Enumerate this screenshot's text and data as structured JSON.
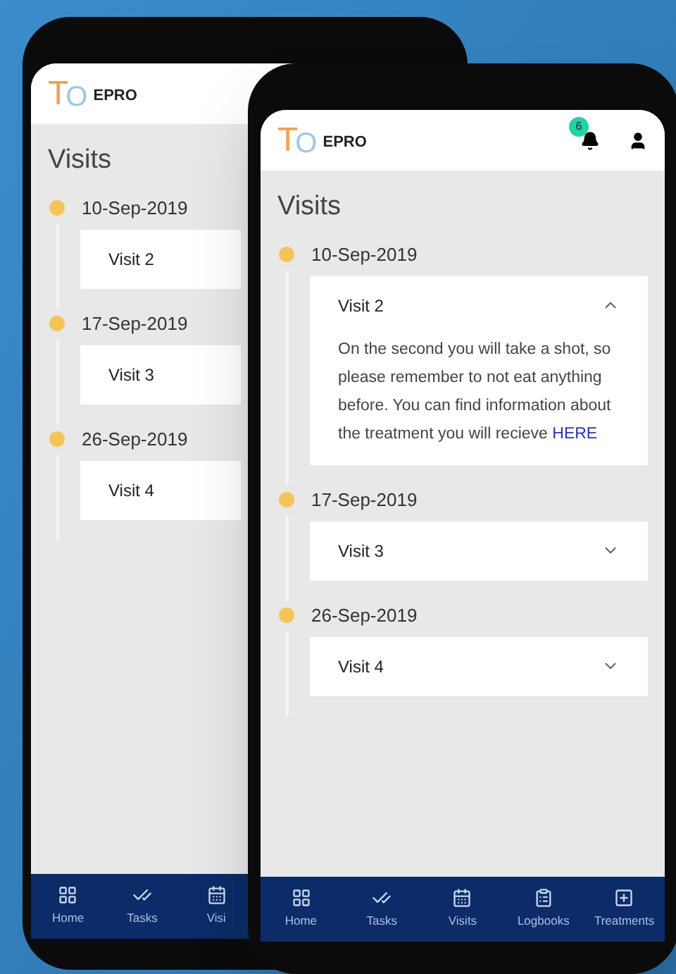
{
  "back_phone": {
    "logo": {
      "first": "T",
      "second": "O"
    },
    "app_name": "EPRO",
    "title": "Visits",
    "visits": [
      {
        "date": "10-Sep-2019",
        "title": "Visit 2"
      },
      {
        "date": "17-Sep-2019",
        "title": "Visit 3"
      },
      {
        "date": "26-Sep-2019",
        "title": "Visit 4"
      }
    ],
    "nav": [
      {
        "label": "Home"
      },
      {
        "label": "Tasks"
      },
      {
        "label": "Visi"
      }
    ]
  },
  "front_phone": {
    "logo": {
      "first": "T",
      "second": "O"
    },
    "app_name": "EPRO",
    "notification_count": "6",
    "title": "Visits",
    "visits": [
      {
        "date": "10-Sep-2019",
        "title": "Visit 2",
        "expanded": true,
        "description": "On the second you will take a shot, so please remember to not eat anything before. You can find information about the treatment you will recieve",
        "link": "HERE"
      },
      {
        "date": "17-Sep-2019",
        "title": "Visit 3",
        "expanded": false
      },
      {
        "date": "26-Sep-2019",
        "title": "Visit 4",
        "expanded": false
      }
    ],
    "nav": [
      {
        "label": "Home"
      },
      {
        "label": "Tasks"
      },
      {
        "label": "Visits"
      },
      {
        "label": "Logbooks"
      },
      {
        "label": "Treatments"
      }
    ]
  }
}
